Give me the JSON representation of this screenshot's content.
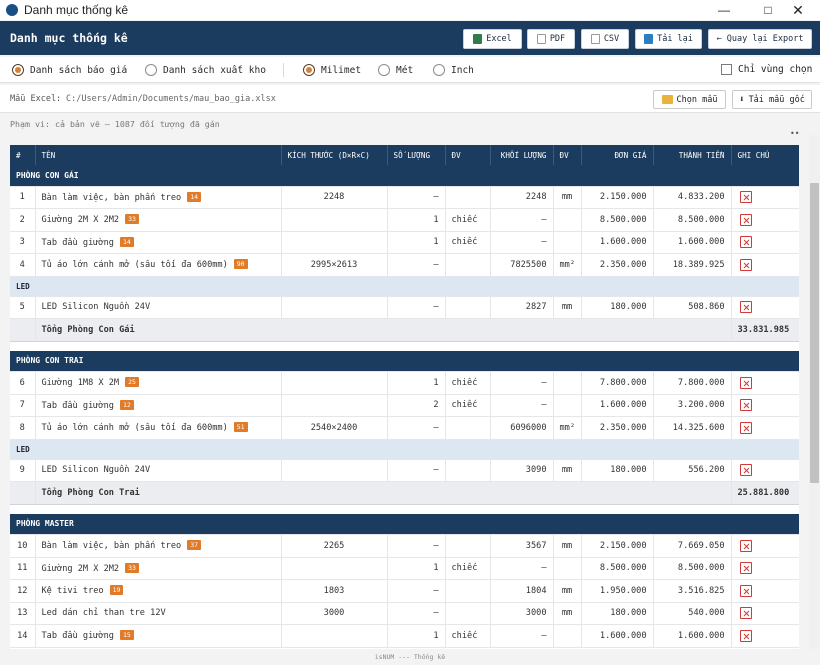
{
  "window": {
    "title": "Danh mục thống kê"
  },
  "header": {
    "title": "Danh mục thống kê",
    "buttons": {
      "excel": "Excel",
      "pdf": "PDF",
      "csv": "CSV",
      "reload": "Tải lại",
      "back": "← Quay lại Export"
    }
  },
  "options": {
    "list_quote": "Danh sách báo giá",
    "list_export": "Danh sách xuất kho",
    "unit_mm": "Milimet",
    "unit_m": "Mét",
    "unit_inch": "Inch",
    "only_area": "Chỉ vùng chọn",
    "selected": {
      "list": "list_quote",
      "unit": "unit_mm"
    }
  },
  "file": {
    "label": "Mẫu Excel:",
    "path": "C:/Users/Admin/Documents/mau_bao_gia.xlsx",
    "choose": "Chọn mẫu",
    "download": "Tải mẫu gốc"
  },
  "scope": "Phạm vi: cả bản vẽ — 1087 đối tượng đã gán",
  "table": {
    "headers": [
      "#",
      "TÊN",
      "KÍCH THƯỚC (D×R×C)",
      "SỐ LƯỢNG",
      "ĐV",
      "KHỐI LƯỢNG",
      "ĐV",
      "ĐƠN GIÁ",
      "THÀNH TIỀN",
      "GHI CHÚ"
    ],
    "rooms": [
      {
        "name": "PHÒNG CON GÁI",
        "rows": [
          {
            "no": "1",
            "name": "Bàn làm việc, bàn phấn treo",
            "badge": "14",
            "size": "2248",
            "qty": "—",
            "unit": "",
            "vol": "2248",
            "vunit": "mm",
            "price": "2.150.000",
            "amount": "4.833.200"
          },
          {
            "no": "2",
            "name": "Giường 2M X 2M2",
            "badge": "33",
            "size": "",
            "qty": "1",
            "unit": "chiếc",
            "vol": "—",
            "vunit": "",
            "price": "8.500.000",
            "amount": "8.500.000"
          },
          {
            "no": "3",
            "name": "Tab đầu giường",
            "badge": "14",
            "size": "",
            "qty": "1",
            "unit": "chiếc",
            "vol": "—",
            "vunit": "",
            "price": "1.600.000",
            "amount": "1.600.000"
          },
          {
            "no": "4",
            "name": "Tủ áo lớn cánh mở (sâu tối đa 600mm)",
            "badge": "90",
            "size": "2995×2613",
            "qty": "—",
            "unit": "",
            "vol": "7825500",
            "vunit": "mm²",
            "price": "2.350.000",
            "amount": "18.389.925"
          }
        ],
        "sub": "LED",
        "subrows": [
          {
            "no": "5",
            "name": "LED Silicon Nguồn 24V",
            "badge": "",
            "size": "",
            "qty": "—",
            "unit": "",
            "vol": "2827",
            "vunit": "mm",
            "price": "180.000",
            "amount": "508.860"
          }
        ],
        "total_label": "Tổng Phòng Con Gái",
        "total": "33.831.985"
      },
      {
        "name": "PHÒNG CON TRAI",
        "rows": [
          {
            "no": "6",
            "name": "Giường 1M8 X 2M",
            "badge": "25",
            "size": "",
            "qty": "1",
            "unit": "chiếc",
            "vol": "—",
            "vunit": "",
            "price": "7.800.000",
            "amount": "7.800.000"
          },
          {
            "no": "7",
            "name": "Tab đầu giường",
            "badge": "12",
            "size": "",
            "qty": "2",
            "unit": "chiếc",
            "vol": "—",
            "vunit": "",
            "price": "1.600.000",
            "amount": "3.200.000"
          },
          {
            "no": "8",
            "name": "Tủ áo lớn cánh mở (sâu tối đa 600mm)",
            "badge": "51",
            "size": "2540×2400",
            "qty": "—",
            "unit": "",
            "vol": "6096000",
            "vunit": "mm²",
            "price": "2.350.000",
            "amount": "14.325.600"
          }
        ],
        "sub": "LED",
        "subrows": [
          {
            "no": "9",
            "name": "LED Silicon Nguồn 24V",
            "badge": "",
            "size": "",
            "qty": "—",
            "unit": "",
            "vol": "3090",
            "vunit": "mm",
            "price": "180.000",
            "amount": "556.200"
          }
        ],
        "total_label": "Tổng Phòng Con Trai",
        "total": "25.881.800"
      },
      {
        "name": "PHÒNG MASTER",
        "rows": [
          {
            "no": "10",
            "name": "Bàn làm việc, bàn phấn treo",
            "badge": "37",
            "size": "2265",
            "qty": "—",
            "unit": "",
            "vol": "3567",
            "vunit": "mm",
            "price": "2.150.000",
            "amount": "7.669.050"
          },
          {
            "no": "11",
            "name": "Giường 2M X 2M2",
            "badge": "33",
            "size": "",
            "qty": "1",
            "unit": "chiếc",
            "vol": "—",
            "vunit": "",
            "price": "8.500.000",
            "amount": "8.500.000"
          },
          {
            "no": "12",
            "name": "Kệ tivi treo",
            "badge": "19",
            "size": "1803",
            "qty": "—",
            "unit": "",
            "vol": "1804",
            "vunit": "mm",
            "price": "1.950.000",
            "amount": "3.516.825"
          },
          {
            "no": "13",
            "name": "Led dán chỉ than tre 12V",
            "badge": "",
            "size": "3000",
            "qty": "—",
            "unit": "",
            "vol": "3000",
            "vunit": "mm",
            "price": "180.000",
            "amount": "540.000"
          },
          {
            "no": "14",
            "name": "Tab đầu giường",
            "badge": "15",
            "size": "",
            "qty": "1",
            "unit": "chiếc",
            "vol": "—",
            "vunit": "",
            "price": "1.600.000",
            "amount": "1.600.000"
          }
        ]
      }
    ]
  },
  "footer": "isNUM --- Thống kê",
  "colors": {
    "header_bg": "#1b3b5f",
    "badge": "#e07b2a",
    "delete": "#d23a3a",
    "accent": "#d3823b"
  }
}
